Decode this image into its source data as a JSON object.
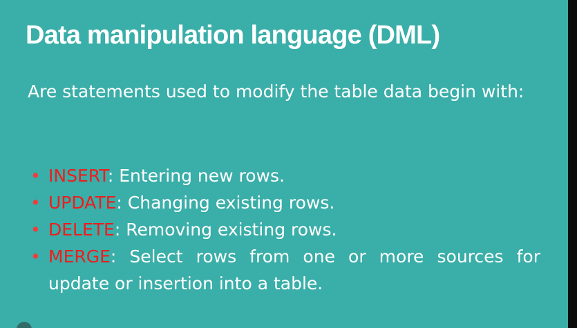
{
  "slide": {
    "title": "Data manipulation language (DML)",
    "intro": "Are statements used to modify the table data begin with:",
    "bullet_symbol": "•",
    "items": [
      {
        "keyword": "INSERT",
        "description": ": Entering new rows."
      },
      {
        "keyword": "UPDATE",
        "description": ": Changing existing rows."
      },
      {
        "keyword": "DELETE",
        "description": ": Removing existing rows."
      },
      {
        "keyword": "MERGE",
        "description": ": Select rows from one or more sources for update or insertion into a table."
      }
    ]
  },
  "colors": {
    "background": "#3aaea8",
    "text": "#ffffff",
    "keyword": "#ee1d1d"
  }
}
